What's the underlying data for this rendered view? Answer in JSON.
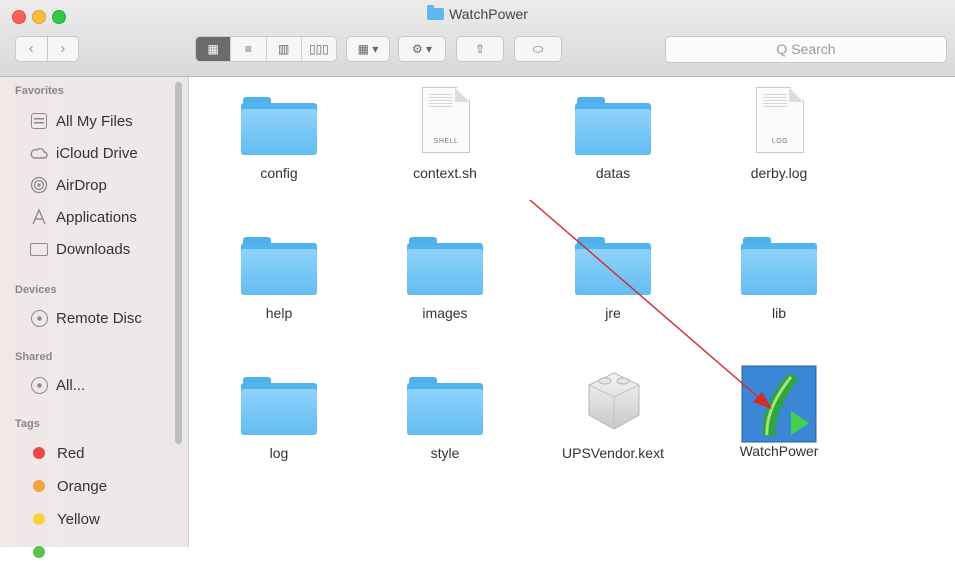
{
  "window": {
    "title": "WatchPower"
  },
  "toolbar": {
    "back_glyph": "‹",
    "forward_glyph": "›",
    "view_buttons": [
      "▦",
      "≡",
      "▥",
      "▯▯▯"
    ],
    "group_button": "▦ ▾",
    "action_button": "⚙ ▾",
    "share_button": "⇧",
    "tag_button": "⬭",
    "search_placeholder": "Q Search"
  },
  "sidebar": {
    "favorites_heading": "Favorites",
    "favorites": [
      {
        "label": "All My Files",
        "icon": "all-files-icon"
      },
      {
        "label": "iCloud Drive",
        "icon": "cloud-icon"
      },
      {
        "label": "AirDrop",
        "icon": "airdrop-icon"
      },
      {
        "label": "Applications",
        "icon": "applications-icon"
      },
      {
        "label": "Downloads",
        "icon": "downloads-folder-icon"
      }
    ],
    "devices_heading": "Devices",
    "devices": [
      {
        "label": "Remote Disc",
        "icon": "disc-icon"
      }
    ],
    "shared_heading": "Shared",
    "shared": [
      {
        "label": "All...",
        "icon": "network-icon"
      }
    ],
    "tags_heading": "Tags",
    "tags": [
      {
        "label": "Red",
        "color": "#e84a4a"
      },
      {
        "label": "Orange",
        "color": "#f5a33b"
      },
      {
        "label": "Yellow",
        "color": "#f7d33a"
      }
    ]
  },
  "files": [
    {
      "name": "config",
      "kind": "folder"
    },
    {
      "name": "context.sh",
      "kind": "document",
      "tag": "SHELL"
    },
    {
      "name": "datas",
      "kind": "folder"
    },
    {
      "name": "derby.log",
      "kind": "document",
      "tag": "LOG"
    },
    {
      "name": "help",
      "kind": "folder"
    },
    {
      "name": "images",
      "kind": "folder"
    },
    {
      "name": "jre",
      "kind": "folder"
    },
    {
      "name": "lib",
      "kind": "folder"
    },
    {
      "name": "log",
      "kind": "folder"
    },
    {
      "name": "style",
      "kind": "folder"
    },
    {
      "name": "UPSVendor.kext",
      "kind": "kext"
    },
    {
      "name": "WatchPower",
      "kind": "application"
    }
  ],
  "annotation": {
    "arrow_color": "#d42a2a"
  }
}
